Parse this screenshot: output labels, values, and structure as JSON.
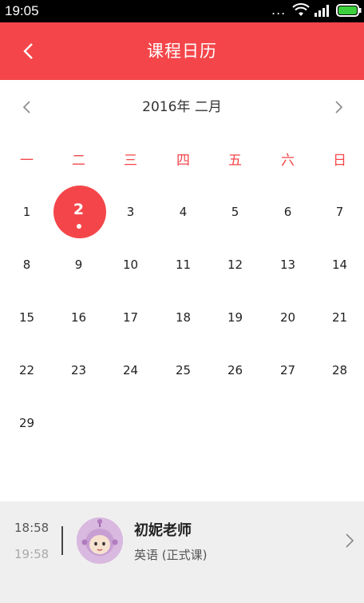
{
  "status_bar": {
    "time": "19:05",
    "more_indicator": "...",
    "icons": [
      "wifi-icon",
      "signal-icon",
      "battery-icon"
    ],
    "battery_color": "#3cd13c"
  },
  "header": {
    "title": "课程日历",
    "background_color": "#f4464a",
    "back_icon": "chevron-left-icon"
  },
  "calendar": {
    "month_label": "2016年 二月",
    "weekdays": [
      "一",
      "二",
      "三",
      "四",
      "五",
      "六",
      "日"
    ],
    "weekday_color": "#f4464a",
    "selected_day": "2",
    "selected_has_event_dot": true,
    "days": [
      "1",
      "2",
      "3",
      "4",
      "5",
      "6",
      "7",
      "8",
      "9",
      "10",
      "11",
      "12",
      "13",
      "14",
      "15",
      "16",
      "17",
      "18",
      "19",
      "20",
      "21",
      "22",
      "23",
      "24",
      "25",
      "26",
      "27",
      "28",
      "29"
    ]
  },
  "lesson": {
    "start_time": "18:58",
    "end_time": "19:58",
    "teacher_name": "初妮老师",
    "course_label": "英语 (正式课)",
    "avatar_icon": "teacher-avatar-icon"
  }
}
